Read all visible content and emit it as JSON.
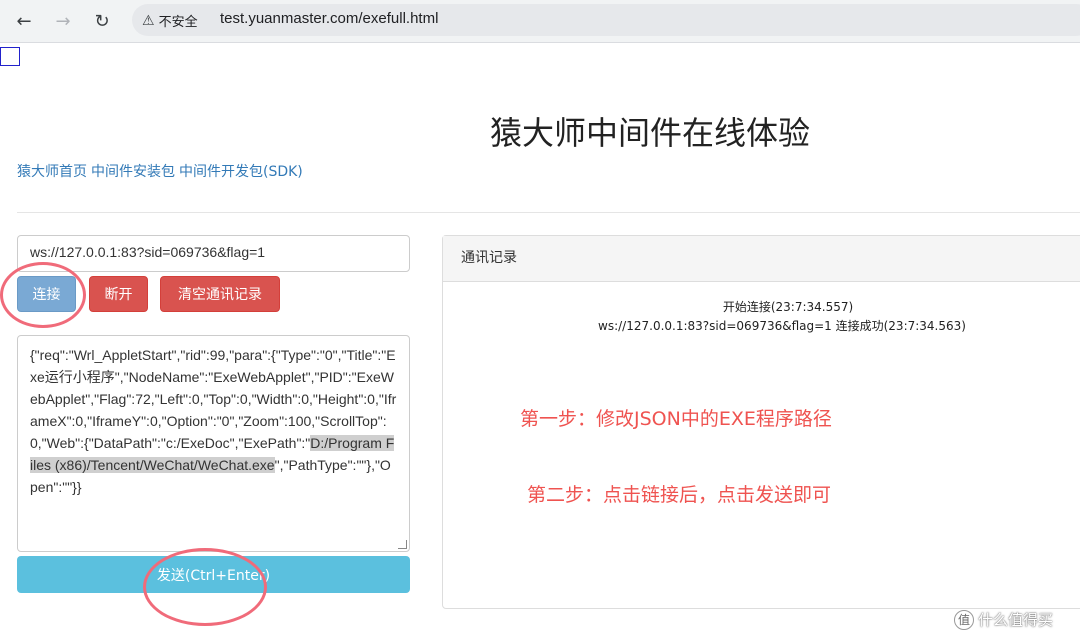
{
  "browser": {
    "security_label": "不安全",
    "url": "test.yuanmaster.com/exefull.html"
  },
  "page": {
    "title": "猿大师中间件在线体验",
    "links": [
      "猿大师首页",
      "中间件安装包",
      "中间件开发包(SDK)"
    ],
    "ws_url": "ws://127.0.0.1:83?sid=069736&flag=1",
    "buttons": {
      "connect": "连接",
      "disconnect": "断开",
      "clear": "清空通讯记录",
      "send": "发送(Ctrl+Enter)"
    },
    "json_text_before": "{\"req\":\"Wrl_AppletStart\",\"rid\":99,\"para\":{\"Type\":\"0\",\"Title\":\"Exe运行小程序\",\"NodeName\":\"ExeWebApplet\",\"PID\":\"ExeWebApplet\",\"Flag\":72,\"Left\":0,\"Top\":0,\"Width\":0,\"Height\":0,\"IframeX\":0,\"IframeY\":0,\"Option\":\"0\",\"Zoom\":100,\"ScrollTop\":0,\"Web\":{\"DataPath\":\"c:/ExeDoc\",\"ExePath\":\"",
    "json_text_highlight": "D:/Program Files (x86)/Tencent/WeChat/WeChat.exe",
    "json_text_after": "\",\"PathType\":\"\"},\"Open\":\"\"}}",
    "panel_title": "通讯记录",
    "log": [
      "开始连接(23:7:34.557)",
      "ws://127.0.0.1:83?sid=069736&flag=1 连接成功(23:7:34.563)"
    ]
  },
  "annotations": {
    "step1": "第一步：修改JSON中的EXE程序路径",
    "step2": "第二步：点击链接后，点击发送即可",
    "circle_color": "#f06b7a",
    "text_color": "#ef5350"
  },
  "watermark": "什么值得买",
  "icons": [
    "back-arrow-icon",
    "forward-arrow-icon",
    "reload-icon",
    "warning-icon"
  ]
}
